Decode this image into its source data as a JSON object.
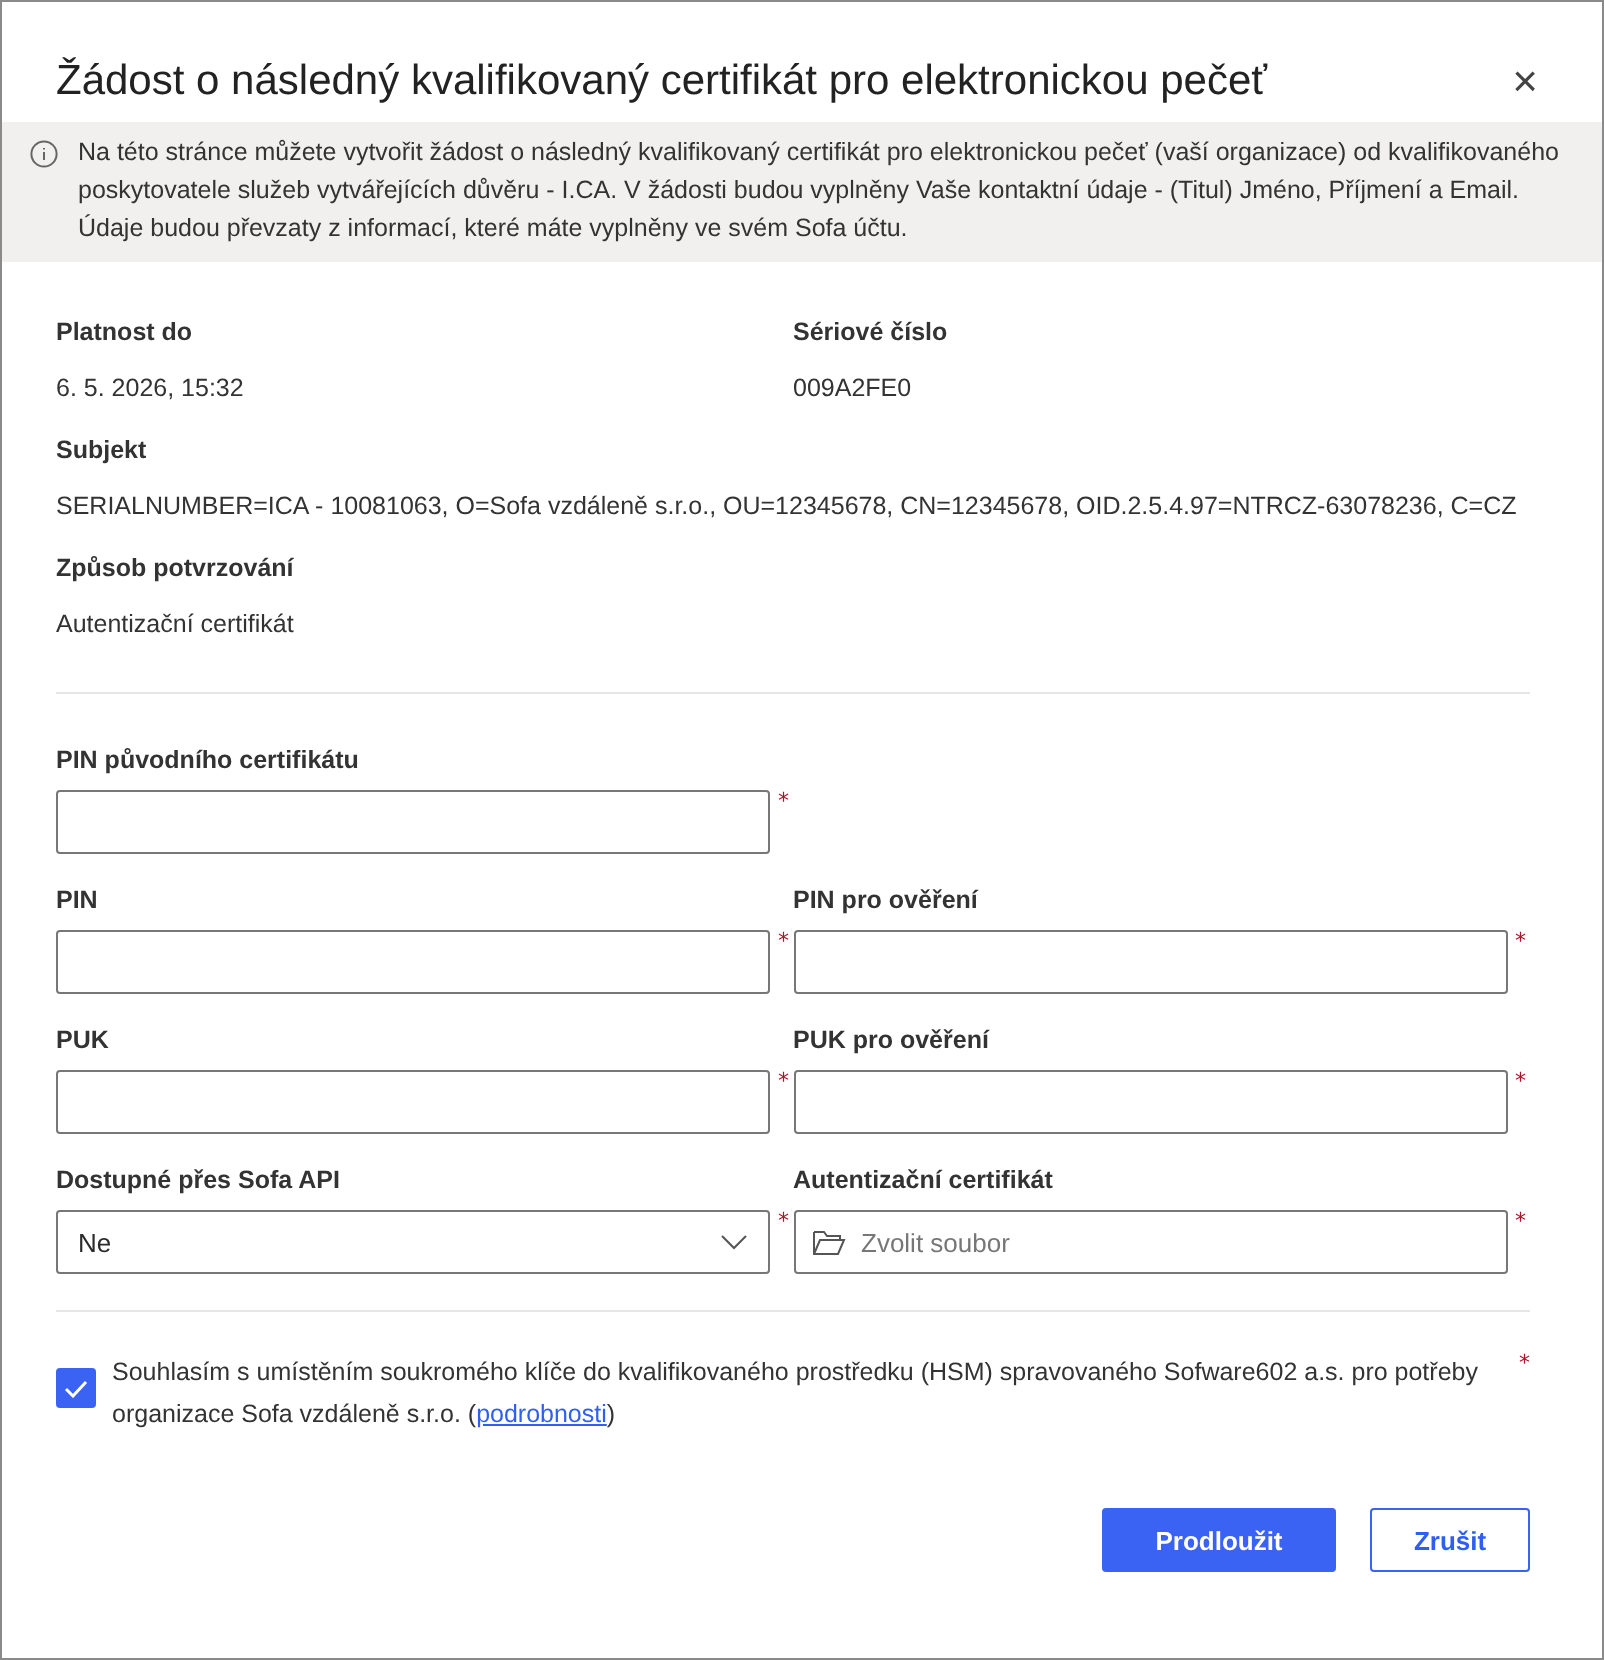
{
  "dialog": {
    "title": "Žádost o následný kvalifikovaný certifikát pro elektronickou pečeť",
    "close": "×"
  },
  "info": "Na této stránce můžete vytvořit žádost o následný kvalifikovaný certifikát pro elektronickou pečeť (vaší organizace) od kvalifikovaného poskytovatele služeb vytvářejících důvěru - I.CA. V žádosti budou vyplněny Vaše kontaktní údaje - (Titul) Jméno, Příjmení a Email. Údaje budou převzaty z informací, které máte vyplněny ve svém Sofa účtu.",
  "detail_rows": [
    [
      {
        "label": "Platnost do",
        "value": "6. 5. 2026, 15:32"
      },
      {
        "label": "Sériové číslo",
        "value": "009A2FE0"
      }
    ],
    [
      {
        "label": "Subjekt",
        "value": "SERIALNUMBER=ICA - 10081063, O=Sofa vzdáleně s.r.o., OU=12345678, CN=12345678, OID.2.5.4.97=NTRCZ-63078236, C=CZ"
      }
    ],
    [
      {
        "label": "Způsob potvrzování",
        "value": "Autentizační certifikát"
      }
    ]
  ],
  "field_rows": [
    [
      {
        "kind": "text",
        "label": "PIN původního certifikátu",
        "required_mark": "*"
      }
    ],
    [
      {
        "kind": "text",
        "label": "PIN",
        "required_mark": "*"
      },
      {
        "kind": "text",
        "label": "PIN pro ověření",
        "required_mark": "*"
      }
    ],
    [
      {
        "kind": "text",
        "label": "PUK",
        "required_mark": "*"
      },
      {
        "kind": "text",
        "label": "PUK pro ověření",
        "required_mark": "*"
      }
    ],
    [
      {
        "kind": "select",
        "label": "Dostupné přes Sofa API",
        "value": "Ne",
        "required_mark": "*"
      },
      {
        "kind": "file",
        "label": "Autentizační certifikát",
        "placeholder": "Zvolit soubor",
        "required_mark": "*"
      }
    ]
  ],
  "consent": {
    "checked": true,
    "text_before": "Souhlasím s umístěním soukromého klíče do kvalifikovaného prostředku (HSM) spravovaného Sofware602 a.s. pro potřeby organizace Sofa vzdáleně s.r.o. (",
    "link": "podrobnosti",
    "text_after": ")",
    "required_mark": "*"
  },
  "buttons": [
    {
      "label": "Prodloužit",
      "kind": "primary"
    },
    {
      "label": "Zrušit",
      "kind": "secondary"
    }
  ]
}
